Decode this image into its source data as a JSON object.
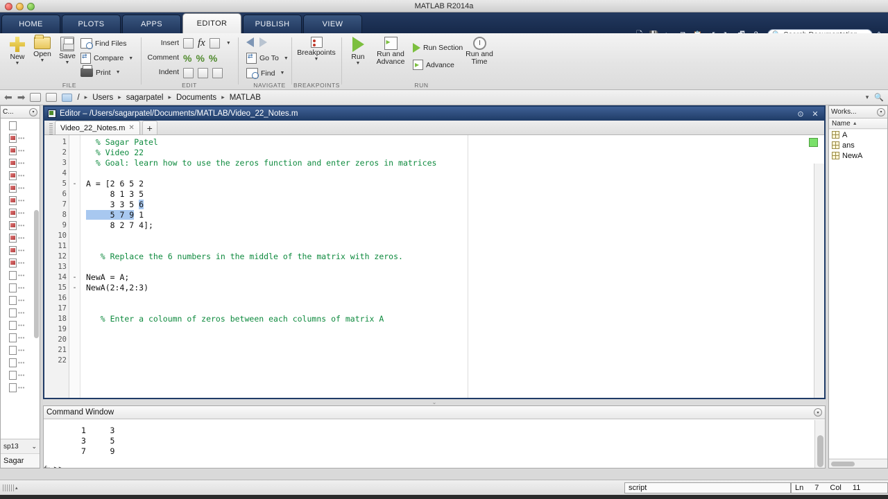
{
  "window": {
    "title": "MATLAB R2014a",
    "traffic_lights": [
      "close",
      "minimize",
      "zoom"
    ]
  },
  "ribbon": {
    "tabs": [
      {
        "label": "HOME",
        "active": false
      },
      {
        "label": "PLOTS",
        "active": false
      },
      {
        "label": "APPS",
        "active": false
      },
      {
        "label": "EDITOR",
        "active": true
      },
      {
        "label": "PUBLISH",
        "active": false
      },
      {
        "label": "VIEW",
        "active": false
      }
    ],
    "quick_access": [
      "new-file-icon",
      "save-icon",
      "cut-icon",
      "copy-icon",
      "paste-icon",
      "undo-icon",
      "redo-icon",
      "switch-window-icon",
      "help-icon"
    ],
    "search": {
      "placeholder": "Search Documentation",
      "icon": "search-icon"
    },
    "groups": [
      {
        "name": "FILE",
        "big_buttons": [
          {
            "label": "New",
            "icon": "new-plus-icon",
            "has_caret": true
          },
          {
            "label": "Open",
            "icon": "open-folder-icon",
            "has_caret": true
          },
          {
            "label": "Save",
            "icon": "save-disk-icon",
            "has_caret": true
          }
        ],
        "small_buttons": [
          {
            "label": "Find Files",
            "icon": "find-files-icon",
            "has_caret": false
          },
          {
            "label": "Compare",
            "icon": "compare-icon",
            "has_caret": true
          },
          {
            "label": "Print",
            "icon": "print-icon",
            "has_caret": true
          }
        ]
      },
      {
        "name": "EDIT",
        "rows": [
          {
            "label": "Insert",
            "icons": [
              "insert-block-icon",
              "fx-function-icon",
              "insert-function-icon"
            ],
            "has_caret": true
          },
          {
            "label": "Comment",
            "icons": [
              "comment-percent-icon",
              "uncomment-icon",
              "wrap-comment-icon"
            ],
            "has_caret": false
          },
          {
            "label": "Indent",
            "icons": [
              "smart-indent-icon",
              "indent-right-icon",
              "indent-left-icon"
            ],
            "has_caret": false
          }
        ]
      },
      {
        "name": "NAVIGATE",
        "small_buttons": [
          {
            "label": "",
            "icon": "back-arrow-icon",
            "has_caret": false
          },
          {
            "label": "Go To",
            "icon": "goto-icon",
            "has_caret": true
          },
          {
            "label": "Find",
            "icon": "find-magnifier-icon",
            "has_caret": true
          }
        ]
      },
      {
        "name": "BREAKPOINTS",
        "big_buttons": [
          {
            "label": "Breakpoints",
            "icon": "breakpoints-icon",
            "has_caret": true
          }
        ]
      },
      {
        "name": "RUN",
        "big_buttons": [
          {
            "label": "Run",
            "icon": "run-play-icon",
            "has_caret": true
          },
          {
            "label": "Run and Advance",
            "icon": "run-advance-icon",
            "has_caret": false
          },
          {
            "label": "Run and Time",
            "icon": "run-time-icon",
            "has_caret": false
          }
        ],
        "small_buttons": [
          {
            "label": "Run Section",
            "icon": "run-section-icon",
            "has_caret": false
          },
          {
            "label": "Advance",
            "icon": "advance-icon",
            "has_caret": false
          }
        ]
      }
    ]
  },
  "address_bar": {
    "back_icon": "back-arrow-icon",
    "forward_icon": "forward-arrow-icon",
    "up_icon": "up-folder-icon",
    "browse_icon": "browse-folder-icon",
    "folder_icon": "folder-icon",
    "root": "/",
    "crumbs": [
      "Users",
      "sagarpatel",
      "Documents",
      "MATLAB"
    ],
    "separator": "▸",
    "overflow_icon": "chevron-down-icon",
    "search_icon": "search-icon"
  },
  "current_folder": {
    "title": "C...",
    "collapse_icon": "chevron-down-icon",
    "file_rows": 22,
    "selected_folder": "sp13",
    "dropdown_icon": "chevron-down-icon",
    "user_label": "Sagar"
  },
  "editor": {
    "window_title": "Editor – /Users/sagarpatel/Documents/MATLAB/Video_22_Notes.m",
    "title_icon": "editor-document-icon",
    "undock_icon": "undock-icon",
    "close_icon": "close-icon",
    "tab": {
      "label": "Video_22_Notes.m",
      "close_icon": "close-icon"
    },
    "new_tab_icon": "plus-icon",
    "analyzer_status": "ok",
    "analyzer_color": "#7ae06a",
    "lines": [
      {
        "n": 1,
        "mark": "",
        "text": "  % Sagar Patel",
        "type": "comment"
      },
      {
        "n": 2,
        "mark": "",
        "text": "  % Video 22",
        "type": "comment"
      },
      {
        "n": 3,
        "mark": "",
        "text": "  % Goal: learn how to use the zeros function and enter zeros in matrices",
        "type": "comment"
      },
      {
        "n": 4,
        "mark": "",
        "text": "",
        "type": "blank"
      },
      {
        "n": 5,
        "mark": "-",
        "text": "A = [2 6 5 2",
        "type": "code"
      },
      {
        "n": 6,
        "mark": "",
        "text": "     8 1 3 5",
        "type": "code"
      },
      {
        "n": 7,
        "mark": "",
        "text": "     3 3 5 6",
        "type": "code",
        "select_from": 11,
        "select_to": 12
      },
      {
        "n": 8,
        "mark": "",
        "text": "     5 7 9 1",
        "type": "code",
        "select_from": 0,
        "select_to": 10
      },
      {
        "n": 9,
        "mark": "",
        "text": "     8 2 7 4];",
        "type": "code"
      },
      {
        "n": 10,
        "mark": "",
        "text": "",
        "type": "blank"
      },
      {
        "n": 11,
        "mark": "",
        "text": "",
        "type": "blank"
      },
      {
        "n": 12,
        "mark": "",
        "text": "   % Replace the 6 numbers in the middle of the matrix with zeros.",
        "type": "comment"
      },
      {
        "n": 13,
        "mark": "",
        "text": "",
        "type": "blank"
      },
      {
        "n": 14,
        "mark": "-",
        "text": "NewA = A;",
        "type": "code"
      },
      {
        "n": 15,
        "mark": "-",
        "text": "NewA(2:4,2:3)",
        "type": "code"
      },
      {
        "n": 16,
        "mark": "",
        "text": "",
        "type": "blank"
      },
      {
        "n": 17,
        "mark": "",
        "text": "",
        "type": "blank"
      },
      {
        "n": 18,
        "mark": "",
        "text": "   % Enter a coloumn of zeros between each columns of matrix A",
        "type": "comment"
      },
      {
        "n": 19,
        "mark": "",
        "text": "",
        "type": "blank"
      },
      {
        "n": 20,
        "mark": "",
        "text": "",
        "type": "blank"
      },
      {
        "n": 21,
        "mark": "",
        "text": "",
        "type": "blank"
      },
      {
        "n": 22,
        "mark": "",
        "text": "",
        "type": "blank"
      }
    ],
    "colors": {
      "comment": "#0e8a3e",
      "code": "#111111",
      "selection": "#a8c8f0"
    }
  },
  "command_window": {
    "title": "Command Window",
    "collapse_icon": "chevron-down-icon",
    "output_lines": [
      "1     3",
      "3     5",
      "7     9"
    ],
    "prompt_fx": "fx",
    "prompt": ">>"
  },
  "workspace": {
    "title": "Works...",
    "collapse_icon": "chevron-down-icon",
    "column_header": "Name",
    "sort_indicator": "▲",
    "variables": [
      {
        "name": "A",
        "icon": "matrix-icon"
      },
      {
        "name": "ans",
        "icon": "matrix-icon"
      },
      {
        "name": "NewA",
        "icon": "matrix-icon"
      }
    ]
  },
  "status_bar": {
    "grip_icon": "resize-grip-icon",
    "file_type": "script",
    "line_label": "Ln",
    "line_value": "7",
    "col_label": "Col",
    "col_value": "11"
  }
}
